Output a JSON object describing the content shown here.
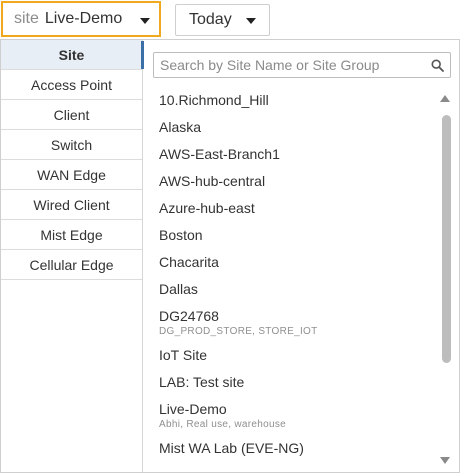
{
  "site_selector": {
    "prefix": "site",
    "value": "Live-Demo"
  },
  "time_selector": {
    "label": "Today"
  },
  "categories": [
    {
      "label": "Site",
      "active": true
    },
    {
      "label": "Access Point"
    },
    {
      "label": "Client"
    },
    {
      "label": "Switch"
    },
    {
      "label": "WAN Edge"
    },
    {
      "label": "Wired Client"
    },
    {
      "label": "Mist Edge"
    },
    {
      "label": "Cellular Edge"
    }
  ],
  "search": {
    "placeholder": "Search by Site Name or Site Group",
    "value": ""
  },
  "sites": [
    {
      "name": "10.Richmond_Hill"
    },
    {
      "name": "Alaska"
    },
    {
      "name": "AWS-East-Branch1"
    },
    {
      "name": "AWS-hub-central"
    },
    {
      "name": "Azure-hub-east"
    },
    {
      "name": "Boston"
    },
    {
      "name": "Chacarita"
    },
    {
      "name": "Dallas"
    },
    {
      "name": "DG24768",
      "tags": "DG_PROD_STORE, STORE_IOT"
    },
    {
      "name": "IoT Site"
    },
    {
      "name": "LAB: Test site"
    },
    {
      "name": "Live-Demo",
      "tags": "Abhi, Real use, warehouse"
    },
    {
      "name": "Mist WA Lab (EVE-NG)"
    }
  ],
  "colors": {
    "highlight_border": "#f0a81e",
    "active_category_bg": "#e8eef5",
    "active_marker": "#3b6fa8",
    "scroll_thumb": "#bdbdbd"
  },
  "icons": {
    "site_caret": "chevron-down-icon",
    "today_caret": "chevron-down-icon",
    "search": "search-icon",
    "scroll_up": "triangle-up-icon",
    "scroll_down": "triangle-down-icon"
  }
}
